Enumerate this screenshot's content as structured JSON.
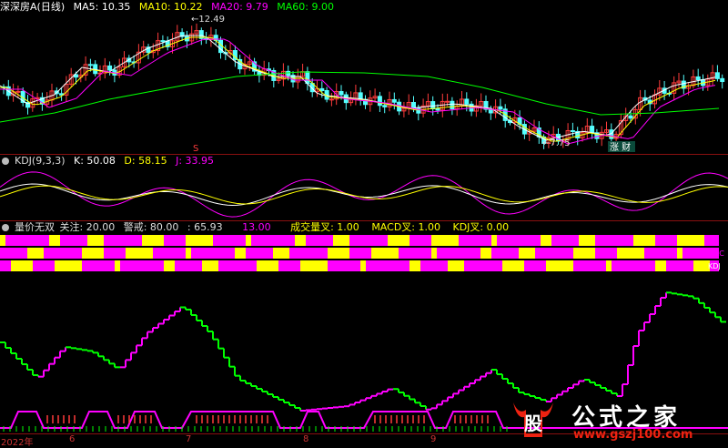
{
  "price_panel": {
    "title": "深深房A",
    "period": "(日线)",
    "ma": [
      {
        "label": "MA5: 10.35",
        "color": "#ffffff"
      },
      {
        "label": "MA10: 10.22",
        "color": "#ffff00"
      },
      {
        "label": "MA20: 9.79",
        "color": "#ff00ff"
      },
      {
        "label": "MA60: 9.00",
        "color": "#00ff00"
      }
    ],
    "high_label": "12.49",
    "low_label": "7.75",
    "marker_s": "S",
    "tag_text": "涨 财"
  },
  "kdj_panel": {
    "title": "KDJ(9,3,3)",
    "k": "K: 50.08",
    "d": "D: 58.15",
    "j": "J: 33.95"
  },
  "indicator_panel": {
    "title": "量价无双",
    "focus": "关注: 20.00",
    "warn": "警戒: 80.00",
    "v3": ": 65.93",
    "v4": "13.00",
    "cross_vol": "成交量叉: 1.00",
    "macd_cross": "MACD叉: 1.00",
    "kdj_cross": "KDJ叉: 0.00",
    "row_tags": [
      "MAC",
      "KDJ"
    ]
  },
  "x_axis": {
    "labels": [
      "2022年",
      "6",
      "7",
      "8",
      "9"
    ]
  },
  "watermark": {
    "logo_char": "股",
    "name": "公式之家",
    "url": "www.gszj100.com"
  },
  "colors": {
    "up": "#ff3b3b",
    "down": "#54ffff",
    "grid": "#8a1010",
    "magenta": "#ff00ff",
    "yellow": "#ffff00",
    "green": "#00ff00"
  }
}
